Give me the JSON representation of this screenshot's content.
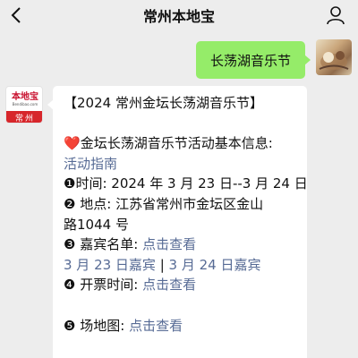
{
  "header": {
    "title": "常州本地宝",
    "back_icon": "chevron-left-icon",
    "user_icon": "person-icon"
  },
  "outgoing": {
    "message": "长荡湖音乐节"
  },
  "incoming": {
    "avatar": {
      "name": "本地宝",
      "url": "Bendibao.com",
      "city": "常州"
    },
    "title_line": "【2024 常州金坛长荡湖音乐节】",
    "heart_icon": "❤️",
    "info_heading": "金坛长荡湖音乐节活动基本信息:",
    "guide_link": "活动指南",
    "time_label": "❶时间:",
    "time_value": "2024 年 3 月 23 日--3 月 24 日",
    "location_label": "❷ 地点:",
    "location_value_1": "江苏省常州市金坛区金山",
    "location_value_2": "路1044 号",
    "guests_label": "❸ 嘉宾名单:",
    "guests_link": "点击查看",
    "guest_day1_link": "3 月 23 日嘉宾",
    "separator": " | ",
    "guest_day2_link": "3 月 24 日嘉宾",
    "ticket_label": "❹ 开票时间:",
    "ticket_link": "点击查看",
    "map_label": "❺ 场地图:",
    "map_link": "点击查看"
  },
  "colors": {
    "background": "#ededed",
    "outgoing_bubble": "#95ec69",
    "link": "#576b95",
    "brand_red": "#d7262b"
  }
}
